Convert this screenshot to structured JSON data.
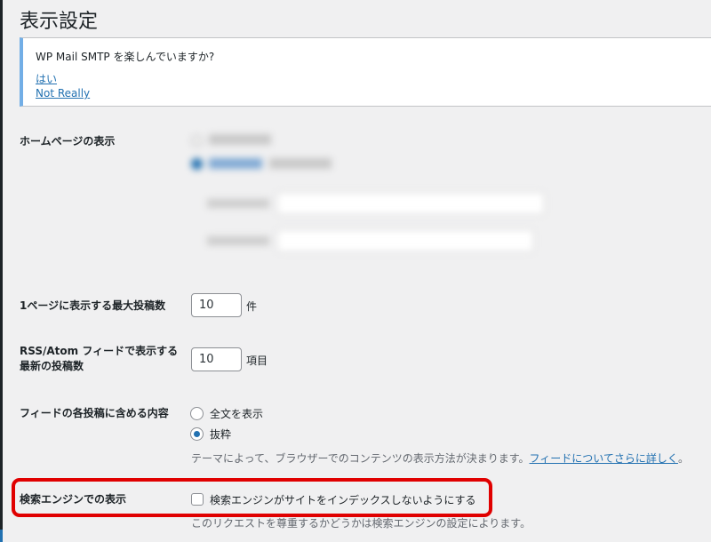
{
  "page": {
    "title": "表示設定"
  },
  "notice": {
    "message": "WP Mail SMTP を楽しんでいますか?",
    "yes_link": "はい",
    "no_link": "Not Really"
  },
  "homepage": {
    "label": "ホームページの表示"
  },
  "posts_per_page": {
    "label": "1ページに表示する最大投稿数",
    "value": "10",
    "unit": "件"
  },
  "feed_items": {
    "label_line1": "RSS/Atom フィードで表示する",
    "label_line2": "最新の投稿数",
    "value": "10",
    "unit": "項目"
  },
  "feed_content": {
    "label": "フィードの各投稿に含める内容",
    "options": [
      {
        "label": "全文を表示",
        "checked": false
      },
      {
        "label": "抜粋",
        "checked": true
      }
    ],
    "description": "テーマによって、ブラウザーでのコンテンツの表示方法が決まります。",
    "description_link": "フィードについてさらに詳しく",
    "description_end": "。"
  },
  "search_visibility": {
    "label": "検索エンジンでの表示",
    "checkbox_label": "検索エンジンがサイトをインデックスしないようにする",
    "checked": false,
    "description": "このリクエストを尊重するかどうかは検索エンジンの設定によります。"
  },
  "colors": {
    "accent": "#2271b1",
    "highlight": "#e00000",
    "notice_border": "#72aee6"
  }
}
